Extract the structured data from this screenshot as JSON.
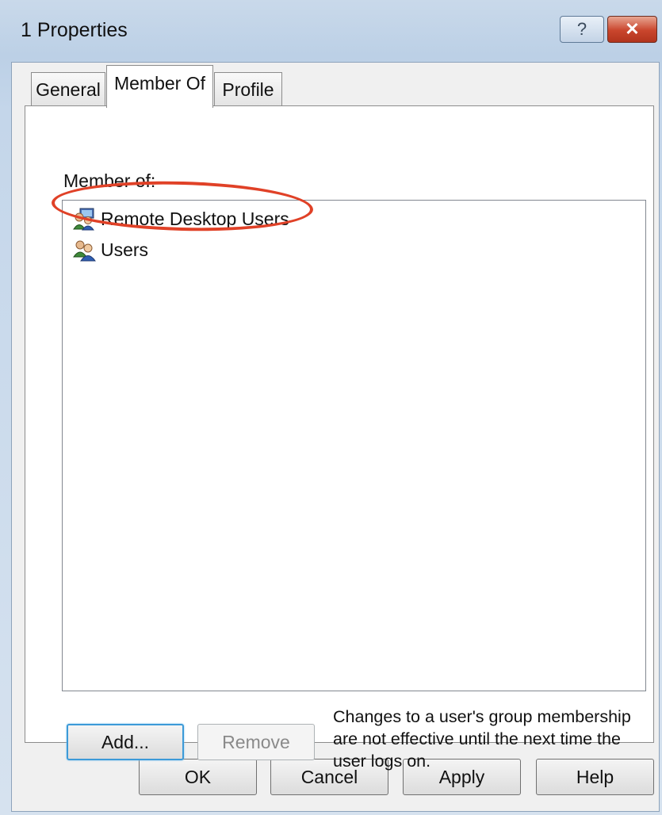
{
  "window": {
    "title": "1 Properties",
    "help_glyph": "?",
    "close_glyph": "✕"
  },
  "tabs": [
    {
      "label": "General",
      "active": false
    },
    {
      "label": "Member Of",
      "active": true
    },
    {
      "label": "Profile",
      "active": false
    }
  ],
  "member_of": {
    "label": "Member of:",
    "groups": [
      {
        "name": "Remote Desktop Users",
        "icon": "group-icon",
        "highlighted": true
      },
      {
        "name": "Users",
        "icon": "group-icon",
        "highlighted": false
      }
    ],
    "highlight_color": "#e04127"
  },
  "actions": {
    "add_label": "Add...",
    "remove_label": "Remove",
    "remove_enabled": false,
    "note": "Changes to a user's group membership are not effective until the next time the user logs on."
  },
  "footer": {
    "ok_label": "OK",
    "cancel_label": "Cancel",
    "apply_label": "Apply",
    "help_label": "Help"
  }
}
